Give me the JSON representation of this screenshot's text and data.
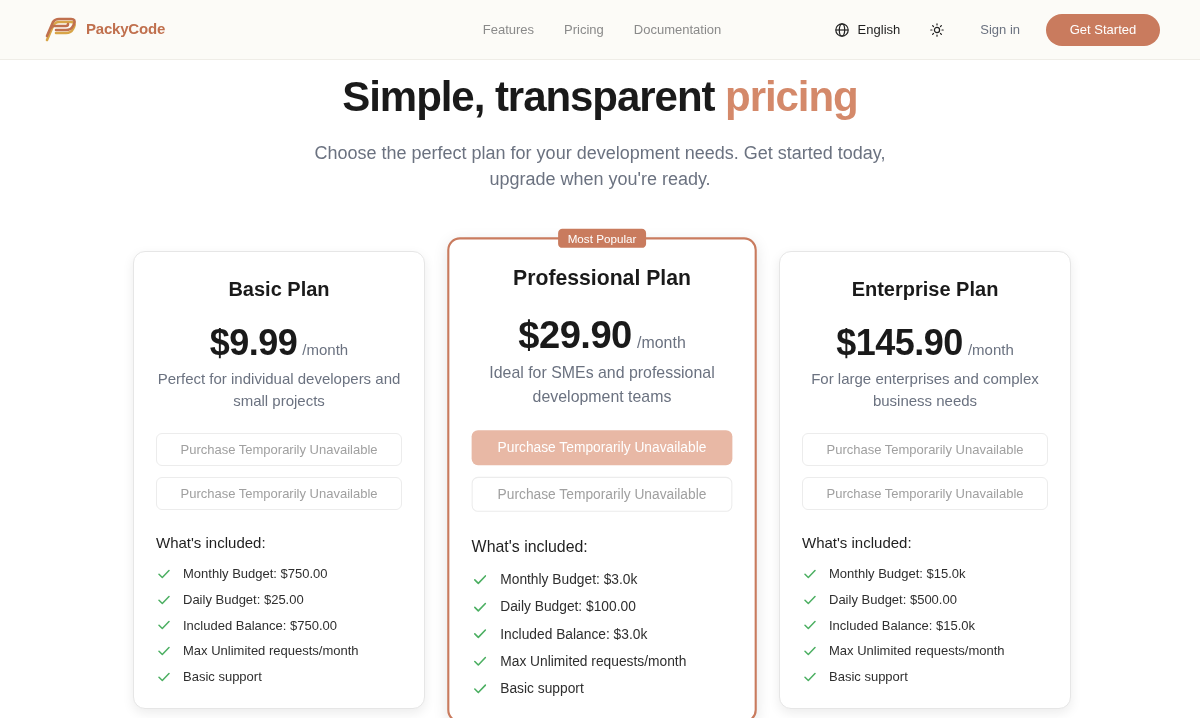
{
  "header": {
    "brand": "PackyCode",
    "nav": [
      {
        "label": "Features"
      },
      {
        "label": "Pricing"
      },
      {
        "label": "Documentation"
      }
    ],
    "language": "English",
    "sign_in": "Sign in",
    "cta": "Get Started"
  },
  "hero": {
    "title": "Simple, transparent",
    "title_highlight": "pricing",
    "subtitle": "Choose the perfect plan for your development needs. Get started today, upgrade when you're ready."
  },
  "plans": [
    {
      "name": "Basic Plan",
      "featured": false,
      "price": "$9.99",
      "period": "/month",
      "description": "Perfect for individual developers and small projects",
      "buttons": [
        {
          "label": "Purchase Temporarily Unavailable",
          "primary": false,
          "disabled": true
        },
        {
          "label": "Purchase Temporarily Unavailable",
          "primary": false,
          "disabled": true
        }
      ],
      "features_heading": "What's included:",
      "features": [
        "Monthly Budget: $750.00",
        "Daily Budget: $25.00",
        "Included Balance: $750.00",
        "Max Unlimited requests/month",
        "Basic support"
      ]
    },
    {
      "name": "Professional Plan",
      "featured": true,
      "badge": "Most Popular",
      "price": "$29.90",
      "period": "/month",
      "description": "Ideal for SMEs and professional development teams",
      "buttons": [
        {
          "label": "Purchase Temporarily Unavailable",
          "primary": true,
          "disabled": true
        },
        {
          "label": "Purchase Temporarily Unavailable",
          "primary": false,
          "disabled": true
        }
      ],
      "features_heading": "What's included:",
      "features": [
        "Monthly Budget: $3.0k",
        "Daily Budget: $100.00",
        "Included Balance: $3.0k",
        "Max Unlimited requests/month",
        "Basic support"
      ]
    },
    {
      "name": "Enterprise Plan",
      "featured": false,
      "price": "$145.90",
      "period": "/month",
      "description": "For large enterprises and complex business needs",
      "buttons": [
        {
          "label": "Purchase Temporarily Unavailable",
          "primary": false,
          "disabled": true
        },
        {
          "label": "Purchase Temporarily Unavailable",
          "primary": false,
          "disabled": true
        }
      ],
      "features_heading": "What's included:",
      "features": [
        "Monthly Budget: $15.0k",
        "Daily Budget: $500.00",
        "Included Balance: $15.0k",
        "Max Unlimited requests/month",
        "Basic support"
      ]
    }
  ]
}
